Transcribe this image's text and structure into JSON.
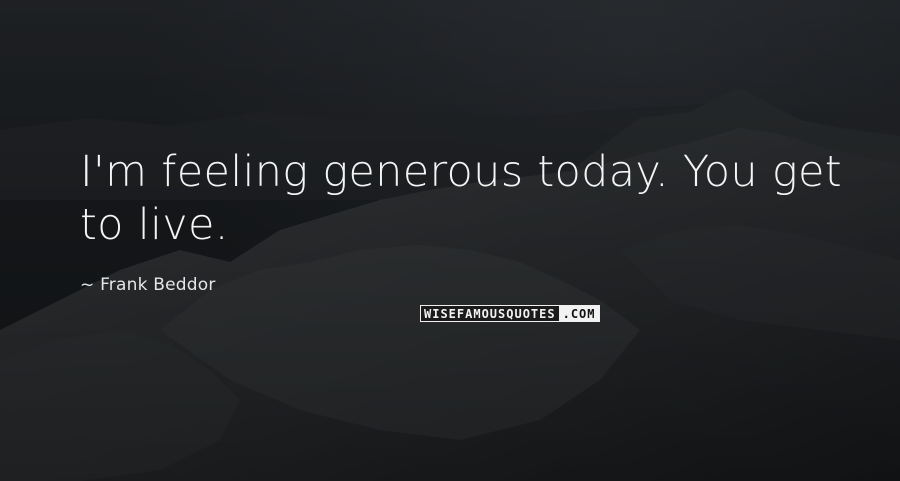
{
  "quote": {
    "text": "I'm feeling generous today. You get to live."
  },
  "author": {
    "dash": "~",
    "name": "Frank Beddor"
  },
  "watermark": {
    "left_text": "WISEFAMOUSQUOTES",
    "right_text": ".COM"
  },
  "colors": {
    "quote_text": "#f4f4f4",
    "background": "#1c1f23"
  }
}
